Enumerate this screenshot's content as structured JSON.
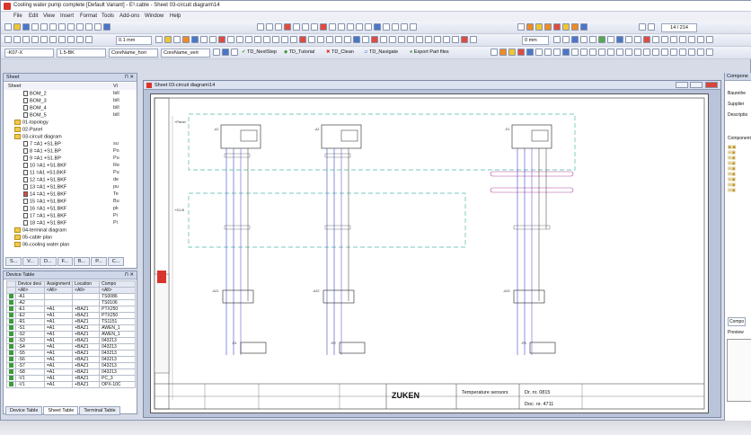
{
  "window": {
    "title": "Cooling water pump complete [Default Variant] - E³.cable - Sheet 03-circuit diagram\\14"
  },
  "menu": [
    "File",
    "Edit",
    "View",
    "Insert",
    "Format",
    "Tools",
    "Add-ons",
    "Window",
    "Help"
  ],
  "toolbar": {
    "line_width": "0.1 mm",
    "text_size": "0 mm",
    "page_counter": "14 / 214",
    "device_field": "-K07-X",
    "size_field": "1.5-BK",
    "core_name_hori": "CoreName_hori",
    "core_name_vert": "CoreName_vert",
    "macros": [
      "TD_NextStep",
      "TD_Tutorial",
      "TD_Clean",
      "TD_Navigate",
      "Export Part files"
    ]
  },
  "sheet_panel": {
    "title": "Sheet",
    "col_header": "Sheet",
    "col_header2": "Vi",
    "items": [
      {
        "label": "BOM_2",
        "right": "bill",
        "indent": 1,
        "kind": "doc"
      },
      {
        "label": "BOM_3",
        "right": "bill",
        "indent": 1,
        "kind": "doc"
      },
      {
        "label": "BOM_4",
        "right": "bill",
        "indent": 1,
        "kind": "doc"
      },
      {
        "label": "BOM_5",
        "right": "bill",
        "indent": 1,
        "kind": "doc"
      },
      {
        "label": "01-topology",
        "right": "",
        "indent": 0,
        "kind": "folder"
      },
      {
        "label": "02-Panel",
        "right": "",
        "indent": 0,
        "kind": "folder"
      },
      {
        "label": "03-circuit diagram",
        "right": "",
        "indent": 0,
        "kind": "folder"
      },
      {
        "label": "7 =A1 +S1.BP",
        "right": "su",
        "indent": 1,
        "kind": "doc"
      },
      {
        "label": "8 =A1 +S1.BP",
        "right": "Po",
        "indent": 1,
        "kind": "doc"
      },
      {
        "label": "9 =A1 +S1.BP",
        "right": "Pu",
        "indent": 1,
        "kind": "doc"
      },
      {
        "label": "10 =A1 +S1.BKF",
        "right": "Re",
        "indent": 1,
        "kind": "doc"
      },
      {
        "label": "11 =A1 +S1.BKF",
        "right": "Pu",
        "indent": 1,
        "kind": "doc"
      },
      {
        "label": "12 =A1 +S1.BKF",
        "right": "de",
        "indent": 1,
        "kind": "doc"
      },
      {
        "label": "13 =A1 +S1.BKF",
        "right": "pu",
        "indent": 1,
        "kind": "doc"
      },
      {
        "label": "14 =A1 +S1.BKF",
        "right": "Te",
        "indent": 1,
        "kind": "doc-red"
      },
      {
        "label": "15 =A1 +S1.BKF",
        "right": "Bu",
        "indent": 1,
        "kind": "doc"
      },
      {
        "label": "16 =A1 +S1.BKF",
        "right": "pk",
        "indent": 1,
        "kind": "doc"
      },
      {
        "label": "17 =A1 +S1.BKF",
        "right": "Pi",
        "indent": 1,
        "kind": "doc"
      },
      {
        "label": "18 =A1 +S1.BKF",
        "right": "Pi",
        "indent": 1,
        "kind": "doc"
      },
      {
        "label": "04-terminal diagram",
        "right": "",
        "indent": 0,
        "kind": "folder"
      },
      {
        "label": "05-cable plan",
        "right": "",
        "indent": 0,
        "kind": "folder"
      },
      {
        "label": "06-cooling water plan",
        "right": "",
        "indent": 0,
        "kind": "folder"
      }
    ],
    "bottom_tabs": [
      "S...",
      "V...",
      "D...",
      "F...",
      "B...",
      "P...",
      "C..."
    ]
  },
  "device_table": {
    "title": "Device Table",
    "headers": [
      "",
      "Device desi",
      "Assignment",
      "Location",
      "Compo"
    ],
    "filter_row": [
      "",
      "<All>",
      "<All>",
      "<All>",
      "<All>"
    ],
    "rows": [
      [
        "",
        "-A1",
        "",
        "",
        "TS0086"
      ],
      [
        "",
        "-A2",
        "",
        "",
        "TS0106"
      ],
      [
        "",
        "-E1",
        "=A1",
        "+BAZ1",
        "PTX250"
      ],
      [
        "",
        "-E2",
        "=A1",
        "+BAZ1",
        "PTX250"
      ],
      [
        "",
        "-R1",
        "=A1",
        "+BAZ1",
        "TS1151"
      ],
      [
        "",
        "-S1",
        "=A1",
        "+BAZ1",
        "AWEN_1"
      ],
      [
        "",
        "-S2",
        "=A1",
        "+BAZ1",
        "AWEN_1"
      ],
      [
        "",
        "-S3",
        "=A1",
        "+BAZ1",
        "043213"
      ],
      [
        "",
        "-S4",
        "=A1",
        "+BAZ1",
        "043213"
      ],
      [
        "",
        "-S5",
        "=A1",
        "+BAZ1",
        "043213"
      ],
      [
        "",
        "-S6",
        "=A1",
        "+BAZ1",
        "043213"
      ],
      [
        "",
        "-S7",
        "=A1",
        "+BAZ1",
        "043213"
      ],
      [
        "",
        "-S8",
        "=A1",
        "+BAZ1",
        "043213"
      ],
      [
        "",
        "-V1",
        "=A1",
        "+BAZ1",
        "PC_3"
      ],
      [
        "",
        "-V1",
        "=A1",
        "+BAZ1",
        "OPX-10C"
      ]
    ],
    "bottom_tabs": [
      "Device Table",
      "Sheet Table",
      "Terminal Table"
    ]
  },
  "document": {
    "title": "Sheet 03-circuit diagram\\14",
    "frame_left_labels": [
      "+Panel",
      "+S1.B"
    ],
    "titleblock": {
      "company": "ZUKEN",
      "description": "Temperature sensors",
      "drawing_no": "Dr. nr. 0815",
      "doc_no": "Doc. nr. 4711"
    },
    "components": [
      "-A1",
      "-A2",
      "-E1",
      "-A21",
      "-A22",
      "-A23",
      "-A21"
    ],
    "sensor_labels": [
      "-R1",
      "-R2",
      "-R3"
    ]
  },
  "right_panel": {
    "title": "Compone",
    "fields": [
      "Baureihe",
      "Supplier",
      "Descriptio"
    ],
    "section": "Component",
    "tab": "Compo",
    "preview": "Preview"
  }
}
